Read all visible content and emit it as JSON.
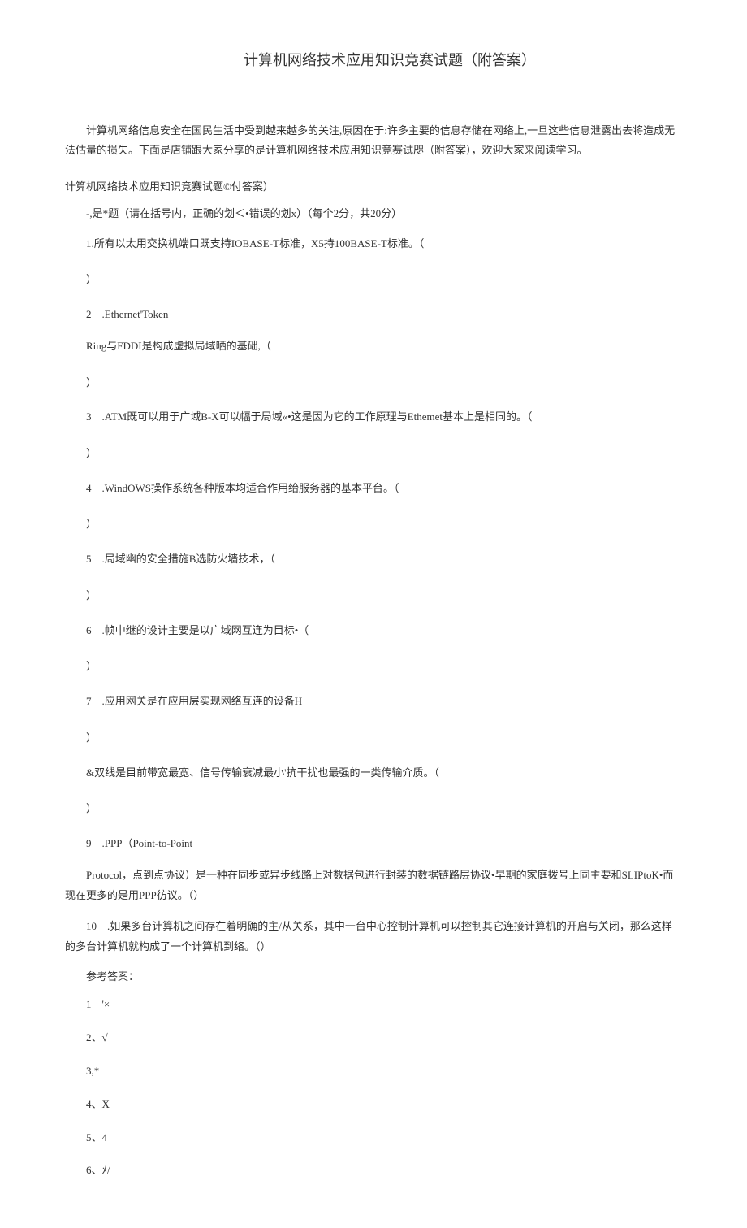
{
  "title": "计算机网络技术应用知识竞赛试题（附答案）",
  "intro": "计算机网络信息安全在国民生活中受到越来越多的关注,原因在于:许多主要的信息存储在网络上,一旦这些信息泄露出去将造成无法估量的损失。下面是店铺跟大家分享的是计算机网络技术应用知识竞赛试咫（附答案），欢迎大家来阅读学习。",
  "sectionHeader": "计算机网络技术应用知识竞赛试题©付答案）",
  "subHeader": "-,是*题（请在括号内，正确的划＜•错误的划x）（每个2分，共20分）",
  "q1": "1.所有以太用交换机端口既支持IOBASE-T标准，X5持100BASE-T标准。（",
  "paren1": "）",
  "q2a": "2　.Ethernet'Token",
  "q2b": "Ring与FDDI是构成虚拟局域晒的基础,（",
  "paren2": "）",
  "q3": "3　.ATM既可以用于广域B-X可以幅于局域«•这是因为它的工作原理与Ethemet基本上是相同的。（",
  "paren3": "）",
  "q4": "4　.WindOWS操作系统各种版本均适合作用绐服务器的基本平台。（",
  "paren4": "）",
  "q5": "5　.局域幽的安全措施B选防火墙技术，（",
  "paren5": "）",
  "q6": "6　.帧中继的设计主要是以广域网互连为目标•（",
  "paren6": "）",
  "q7": "7　.应用网关是在应用层实现网络互连的设备H",
  "paren7": "）",
  "q8": "&双线是目前带宽最宽、信号传输衰减最小'抗干扰也最强的一类传输介质。（",
  "paren8": "）",
  "q9a": "9　.PPP（Point-to-Point",
  "q9b": "Protocol，点到点协议）是一种在同步或异步线路上对数据包进行封装的数据链路层协议•早期的家庭拨号上同主要和SLIPtoK•而现在更多的是用PPP彷议。（）",
  "q10": "10　.如果多台计算机之间存在着明确的主/从关系，其中一台中心控制计算机可以控制其它连接计算机的开启与关闭，那么这样的多台计算机就构成了一个计算机到络。（）",
  "answersLabel": "参考答案：",
  "a1": "1　'×",
  "a2": "2、√",
  "a3": "3,*",
  "a4": "4、X",
  "a5": "5、4",
  "a6": "6、ﾒ/"
}
